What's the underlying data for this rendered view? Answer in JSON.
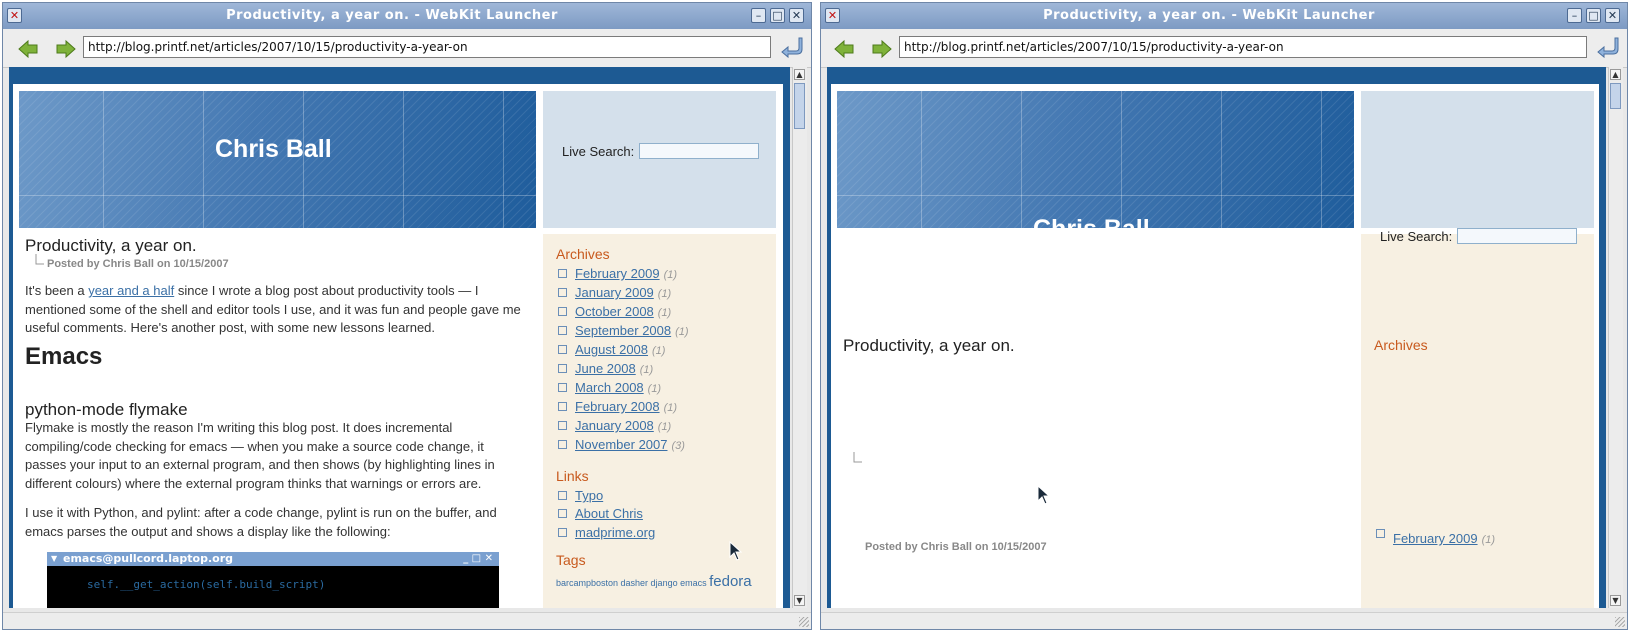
{
  "windows": [
    {
      "title": "Productivity, a year on. - WebKit Launcher",
      "url": "http://blog.printf.net/articles/2007/10/15/productivity-a-year-on"
    },
    {
      "title": "Productivity, a year on. - WebKit Launcher",
      "url": "http://blog.printf.net/articles/2007/10/15/productivity-a-year-on"
    }
  ],
  "blog": {
    "title": "Chris Ball",
    "live_search_label": "Live Search:",
    "post_title": "Productivity, a year on.",
    "posted_by": "Posted by Chris Ball on 10/15/2007",
    "intro_pre": "It's been a ",
    "intro_link": "year and a half",
    "intro_post": " since I wrote a blog post about productivity tools — I mentioned some of the shell and editor tools I use, and it was fun and people gave me useful comments. Here's another post, with some new lessons learned.",
    "h_emacs": "Emacs",
    "h_flymake": "python-mode flymake",
    "flymake_text": "Flymake is mostly the reason I'm writing this blog post. It does incremental compiling/code checking for emacs — when you make a source code change, it passes your input to an external program, and then shows (by highlighting lines in different colours) where the external program thinks that warnings or errors are.",
    "pylint_text": "I use it with Python, and pylint: after a code change, pylint is run on the buffer, and emacs parses the output and shows a display like the following:",
    "emacs_title": "emacs@pullcord.laptop.org",
    "emacs_code": "  self.__get_action(self.build_script)"
  },
  "sidebar": {
    "archives_heading": "Archives",
    "archives": [
      {
        "label": "February 2009",
        "count": "(1)"
      },
      {
        "label": "January 2009",
        "count": "(1)"
      },
      {
        "label": "October 2008",
        "count": "(1)"
      },
      {
        "label": "September 2008",
        "count": "(1)"
      },
      {
        "label": "August 2008",
        "count": "(1)"
      },
      {
        "label": "June 2008",
        "count": "(1)"
      },
      {
        "label": "March 2008",
        "count": "(1)"
      },
      {
        "label": "February 2008",
        "count": "(1)"
      },
      {
        "label": "January 2008",
        "count": "(1)"
      },
      {
        "label": "November 2007",
        "count": "(3)"
      }
    ],
    "links_heading": "Links",
    "links": [
      "Typo",
      "About Chris",
      "madprime.org"
    ],
    "tags_heading": "Tags",
    "tags_small": "barcampboston dasher django emacs ",
    "tags_big": "fedora"
  },
  "colors": {
    "page_bg": "#1d5a93",
    "sidebar_bg": "#f7f0e2",
    "heading_orange": "#c85a1e",
    "link_blue": "#3b70a6"
  }
}
